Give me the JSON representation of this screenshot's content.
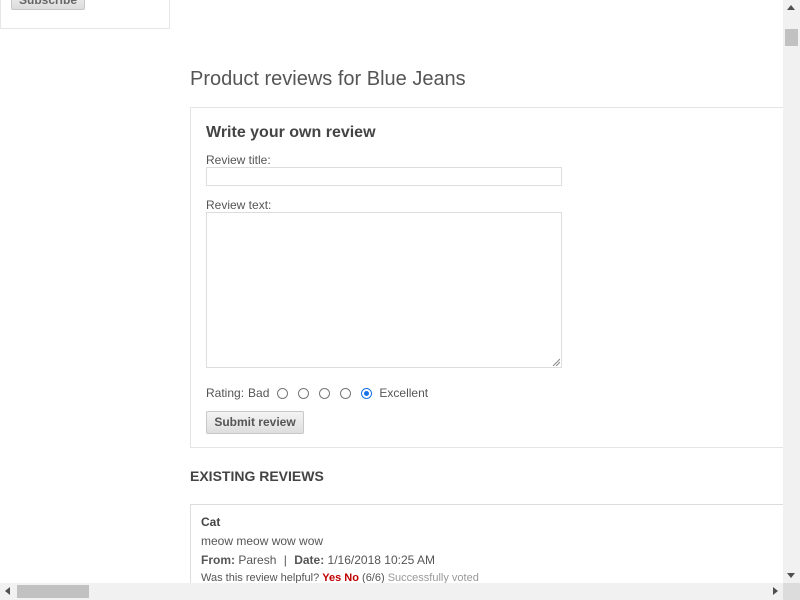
{
  "sidebar": {
    "subscribe_label": "Subscribe"
  },
  "page_title": "Product reviews for Blue Jeans",
  "review_form": {
    "heading": "Write your own review",
    "title_label": "Review title:",
    "title_value": "",
    "text_label": "Review text:",
    "text_value": "",
    "rating_label": "Rating:",
    "rating_low": "Bad",
    "rating_high": "Excellent",
    "rating_options": [
      1,
      2,
      3,
      4,
      5
    ],
    "rating_selected": 5,
    "submit_label": "Submit review"
  },
  "existing_reviews": {
    "heading": "EXISTING REVIEWS",
    "items": [
      {
        "title": "Cat",
        "text": "meow meow wow wow",
        "from_label": "From:",
        "author": "Paresh",
        "separator": "|",
        "date_label": "Date:",
        "date": "1/16/2018 10:25 AM",
        "helpful_question": "Was this review helpful?",
        "yes_label": "Yes",
        "no_label": "No",
        "votes": "(6/6)",
        "vote_status": "Successfully voted"
      }
    ]
  },
  "colors": {
    "vote_link": "#c00000",
    "radio_checked": "#1a73e8",
    "muted_text": "#999999"
  }
}
